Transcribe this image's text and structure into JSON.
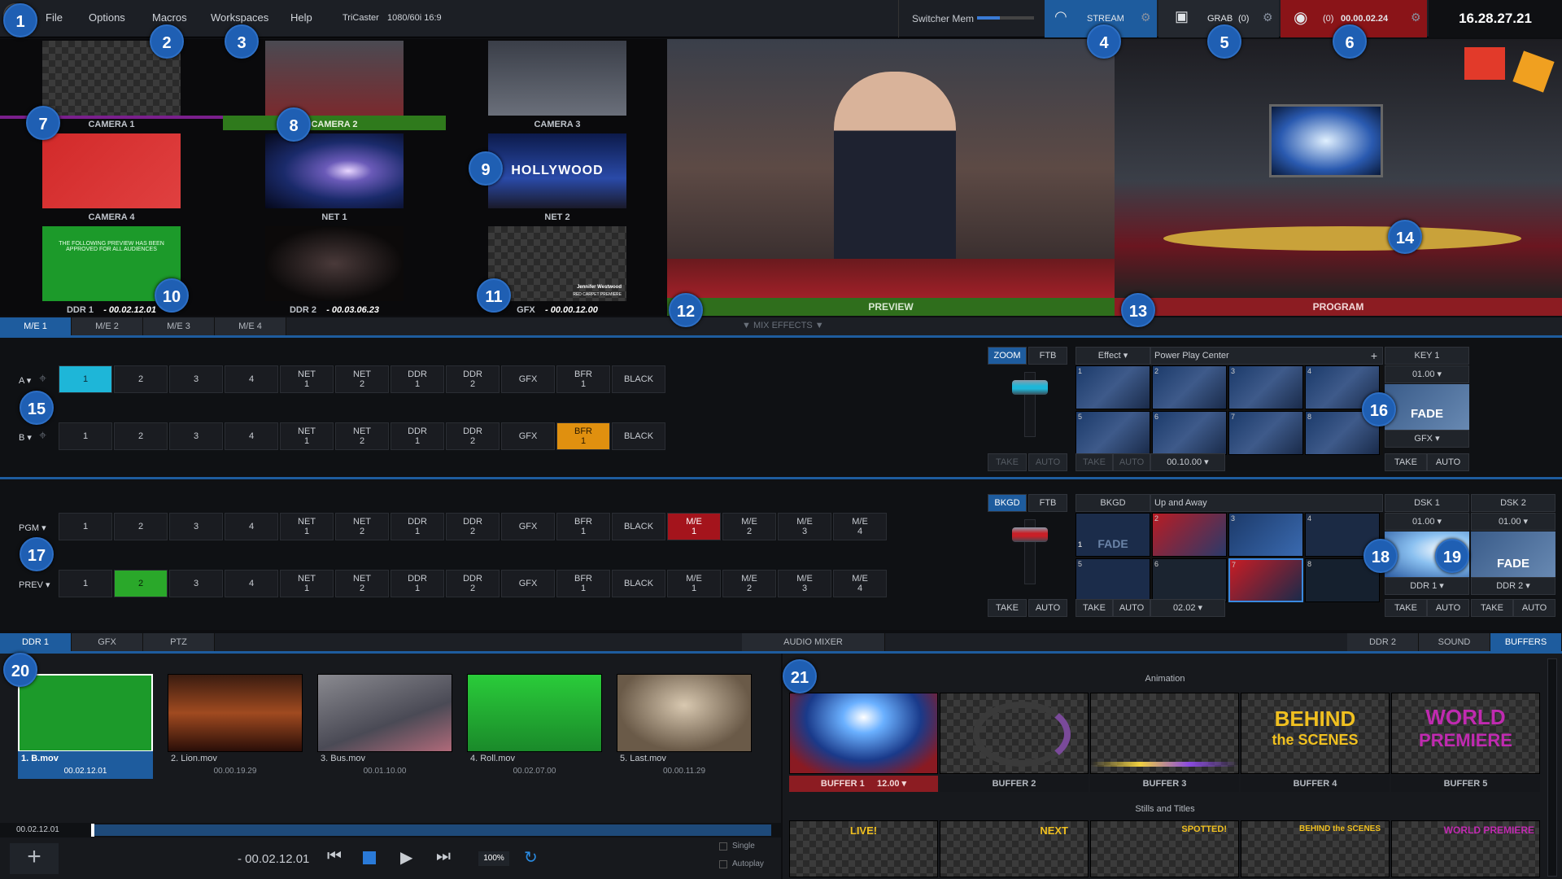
{
  "menu": {
    "items": [
      "File",
      "Options",
      "Macros",
      "Workspaces",
      "Help"
    ],
    "session": "TriCaster",
    "format": "1080/60i 16:9"
  },
  "topbar": {
    "switcher_mem": "Switcher Mem",
    "stream": "STREAM",
    "grab": "GRAB",
    "grab_count": "(0)",
    "rec_count": "(0)",
    "rec_time": "00.00.02.24",
    "clock": "16.28.27.21"
  },
  "callouts": [
    "1",
    "2",
    "3",
    "4",
    "5",
    "6",
    "7",
    "8",
    "9",
    "10",
    "11",
    "12",
    "13",
    "14",
    "15",
    "16",
    "17",
    "18",
    "19",
    "20",
    "21"
  ],
  "sources": [
    {
      "label": "CAMERA 1",
      "bar": "#7a1f8c"
    },
    {
      "label": "CAMERA 2",
      "bar": "#2f7a1c"
    },
    {
      "label": "CAMERA 3"
    },
    {
      "label": "CAMERA 4"
    },
    {
      "label": "NET 1"
    },
    {
      "label": "NET 2"
    },
    {
      "label": "DDR 1",
      "time": "- 00.02.12.01"
    },
    {
      "label": "DDR 2",
      "time": "- 00.03.06.23"
    },
    {
      "label": "GFX",
      "time": "- 00.00.12.00"
    }
  ],
  "thumbs": {
    "hollywood": "HOLLYWOOD",
    "rating_text": "THE FOLLOWING PREVIEW HAS BEEN APPROVED FOR ALL AUDIENCES",
    "gfx_name": "Jennifer Westwood",
    "gfx_title": "RED CARPET PREMIERE"
  },
  "monitors": {
    "preview": "PREVIEW",
    "program": "PROGRAM"
  },
  "me_tabs": [
    "M/E 1",
    "M/E 2",
    "M/E 3",
    "M/E 4"
  ],
  "mix_effects_label": "MIX EFFECTS",
  "me_row_a": {
    "label": "A",
    "buttons": [
      "1",
      "2",
      "3",
      "4",
      "NET\n1",
      "NET\n2",
      "DDR\n1",
      "DDR\n2",
      "GFX",
      "BFR\n1",
      "BLACK"
    ]
  },
  "me_row_b": {
    "label": "B",
    "buttons": [
      "1",
      "2",
      "3",
      "4",
      "NET\n1",
      "NET\n2",
      "DDR\n1",
      "DDR\n2",
      "GFX",
      "BFR\n1",
      "BLACK"
    ]
  },
  "me_transition": {
    "zoom": "ZOOM",
    "ftb": "FTB",
    "take": "TAKE",
    "auto": "AUTO",
    "effect_label": "Effect",
    "effect_name": "Power Play Center",
    "duration": "00.10.00"
  },
  "key1": {
    "label": "KEY 1",
    "rate": "01.00",
    "fade": "FADE",
    "source": "GFX",
    "take": "TAKE",
    "auto": "AUTO"
  },
  "pgm_row": {
    "label": "PGM",
    "buttons": [
      "1",
      "2",
      "3",
      "4",
      "NET\n1",
      "NET\n2",
      "DDR\n1",
      "DDR\n2",
      "GFX",
      "BFR\n1",
      "BLACK",
      "M/E\n1",
      "M/E\n2",
      "M/E\n3",
      "M/E\n4"
    ]
  },
  "prev_row": {
    "label": "PREV",
    "buttons": [
      "1",
      "2",
      "3",
      "4",
      "NET\n1",
      "NET\n2",
      "DDR\n1",
      "DDR\n2",
      "GFX",
      "BFR\n1",
      "BLACK",
      "M/E\n1",
      "M/E\n2",
      "M/E\n3",
      "M/E\n4"
    ]
  },
  "main_transition": {
    "bkgd": "BKGD",
    "ftb": "FTB",
    "take": "TAKE",
    "auto": "AUTO",
    "bkgd_label": "BKGD",
    "effect_name": "Up and Away",
    "fade": "FADE",
    "duration": "02.02"
  },
  "dsk1": {
    "label": "DSK 1",
    "rate": "01.00",
    "source": "DDR 1",
    "take": "TAKE",
    "auto": "AUTO"
  },
  "dsk2": {
    "label": "DSK 2",
    "rate": "01.00",
    "fade": "FADE",
    "source": "DDR 2",
    "take": "TAKE",
    "auto": "AUTO"
  },
  "lower_tabs": [
    "DDR 1",
    "GFX",
    "PTZ"
  ],
  "audio_mixer": "AUDIO MIXER",
  "right_tabs": [
    "DDR 2",
    "SOUND",
    "BUFFERS"
  ],
  "ddr": {
    "clips": [
      {
        "name": "1. B.mov",
        "time": "00.02.12.01"
      },
      {
        "name": "2. Lion.mov",
        "time": "00.00.19.29"
      },
      {
        "name": "3. Bus.mov",
        "time": "00.01.10.00"
      },
      {
        "name": "4. Roll.mov",
        "time": "00.02.07.00"
      },
      {
        "name": "5. Last.mov",
        "time": "00.00.11.29"
      }
    ],
    "position": "00.02.12.01",
    "remaining": "- 00.02.12.01",
    "speed": "100%",
    "single": "Single",
    "autoplay": "Autoplay"
  },
  "buffers": {
    "animation_label": "Animation",
    "stills_label": "Stills and Titles",
    "items": [
      {
        "label": "BUFFER 1",
        "rate": "12.00"
      },
      {
        "label": "BUFFER 2"
      },
      {
        "label": "BUFFER 3"
      },
      {
        "label": "BUFFER 4",
        "art1": "BEHIND",
        "art2": "the SCENES"
      },
      {
        "label": "BUFFER 5",
        "art1": "WORLD",
        "art2": "PREMIERE"
      }
    ],
    "stills": [
      "LIVE!",
      "NEXT",
      "SPOTTED!",
      "BEHIND the SCENES",
      "WORLD PREMIERE"
    ]
  }
}
